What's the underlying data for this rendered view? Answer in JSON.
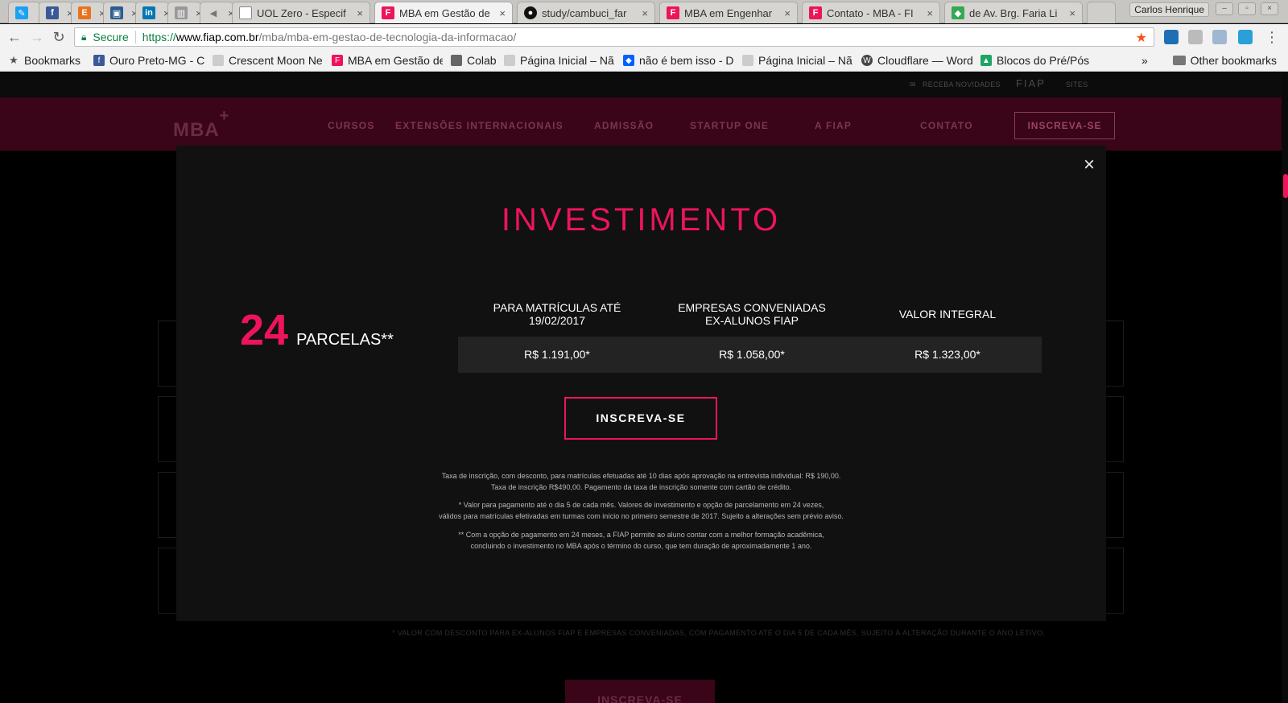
{
  "browser": {
    "tabs": [
      {
        "title": "",
        "icon": "twitter-like"
      },
      {
        "title": "",
        "icon": "facebook"
      },
      {
        "title": "",
        "icon": "etsy"
      },
      {
        "title": "",
        "icon": "favicon"
      },
      {
        "title": "",
        "icon": "linkedin"
      },
      {
        "title": "",
        "icon": "favicon"
      },
      {
        "title": "",
        "icon": "audio"
      },
      {
        "title": "UOL Zero - Especif",
        "icon": "doc"
      },
      {
        "title": "MBA em Gestão de",
        "icon": "fiap",
        "active": true
      },
      {
        "title": "study/cambuci_far",
        "icon": "github"
      },
      {
        "title": "MBA em Engenhar",
        "icon": "fiap"
      },
      {
        "title": "Contato - MBA - FI",
        "icon": "fiap"
      },
      {
        "title": "de Av. Brg. Faria Li",
        "icon": "maps"
      }
    ],
    "user": "Carlos Henrique",
    "address": {
      "secure_label": "Secure",
      "scheme": "https://",
      "host": "www.fiap.com.br",
      "path": "/mba/mba-em-gestao-de-tecnologia-da-informacao/"
    },
    "bookmarks": [
      {
        "label": "Bookmarks",
        "icon": "star"
      },
      {
        "label": "Ouro Preto-MG - C",
        "icon": "facebook"
      },
      {
        "label": "Crescent Moon Ne",
        "icon": "page"
      },
      {
        "label": "MBA em Gestão de",
        "icon": "fiap"
      },
      {
        "label": "Colab",
        "icon": "folder"
      },
      {
        "label": "Página Inicial – Nã",
        "icon": "page"
      },
      {
        "label": "não é bem isso - Dr",
        "icon": "dropbox"
      },
      {
        "label": "Página Inicial – Nã",
        "icon": "page"
      },
      {
        "label": "Cloudflare — Word",
        "icon": "wordpress"
      },
      {
        "label": "Blocos do Pré/Pós",
        "icon": "drive"
      }
    ],
    "other_bookmarks": "Other bookmarks",
    "overflow": "»"
  },
  "site": {
    "topbar": {
      "newsletter": "RECEBA NOVIDADES",
      "brand": "FIAP",
      "sites": "SITES"
    },
    "logo": "MBA",
    "logo_plus": "+",
    "nav": [
      "CURSOS",
      "EXTENSÕES INTERNACIONAIS",
      "ADMISSÃO",
      "STARTUP ONE",
      "A FIAP",
      "CONTATO"
    ],
    "nav_cta": "INSCREVA-SE",
    "bg_note": "* VALOR COM DESCONTO PARA EX-ALUNOS FIAP E EMPRESAS CONVENIADAS, COM PAGAMENTO ATÉ O DIA 5 DE CADA MÊS, SUJEITO À ALTERAÇÃO DURANTE O ANO LETIVO.",
    "bg_cta": "INSCREVA-SE"
  },
  "modal": {
    "close": "×",
    "title": "INVESTIMENTO",
    "installments_number": "24",
    "installments_label": "PARCELAS**",
    "columns": [
      {
        "header_line1": "PARA MATRÍCULAS ATÉ",
        "header_line2": "19/02/2017",
        "price": "R$ 1.191,00*"
      },
      {
        "header_line1": "EMPRESAS CONVENIADAS",
        "header_line2": "EX-ALUNOS FIAP",
        "price": "R$ 1.058,00*"
      },
      {
        "header_line1": "VALOR INTEGRAL",
        "header_line2": "",
        "price": "R$ 1.323,00*"
      }
    ],
    "cta": "INSCREVA-SE",
    "fine_print": [
      "Taxa de inscrição, com desconto, para matrículas efetuadas até 10 dias após aprovação na entrevista individual: R$ 190,00.",
      "Taxa de inscrição R$490,00. Pagamento da taxa de inscrição somente com cartão de crédito.",
      "* Valor para pagamento até o dia 5 de cada mês. Valores de investimento e opção de parcelamento em 24 vezes,",
      "válidos para matrículas efetivadas em turmas com início no primeiro semestre de 2017. Sujeito a alterações sem prévio aviso.",
      "** Com a opção de pagamento em 24 meses, a FIAP permite ao aluno contar com a melhor formação acadêmica,",
      "concluindo o investimento no MBA após o término do curso, que tem duração de aproximadamente 1 ano."
    ]
  },
  "colors": {
    "accent": "#ed145b",
    "modal_bg": "#111111",
    "nav_bg": "#3a0519"
  }
}
